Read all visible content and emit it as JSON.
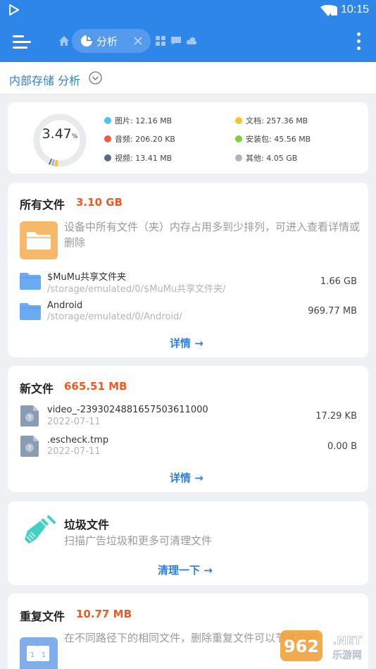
{
  "status_bar": {
    "time": "10:15"
  },
  "toolbar": {
    "active_tab_label": "分析"
  },
  "path": {
    "title": "内部存储 分析"
  },
  "storage_summary": {
    "percent_value": "3.47",
    "percent_sign": "%",
    "legend": [
      {
        "label": "图片: 12.16 MB",
        "color": "#4fc3f0"
      },
      {
        "label": "文档: 257.36 MB",
        "color": "#f7c52a"
      },
      {
        "label": "音频: 206.20 KB",
        "color": "#f05a44"
      },
      {
        "label": "安装包: 45.56 MB",
        "color": "#7dd13b"
      },
      {
        "label": "视频: 13.41 MB",
        "color": "#5a6b82"
      },
      {
        "label": "其他: 4.05 GB",
        "color": "#a9b6c7"
      }
    ]
  },
  "all_files": {
    "title": "所有文件",
    "size": "3.10 GB",
    "description": "设备中所有文件（夹）内存占用多到少排列，可进入查看详情或删除",
    "items": [
      {
        "name": "$MuMu共享文件夹",
        "path": "/storage/emulated/0/$MuMu共享文件夹/",
        "size": "1.66 GB"
      },
      {
        "name": "Android",
        "path": "/storage/emulated/0/Android/",
        "size": "969.77 MB"
      }
    ],
    "detail_label": "详情 →"
  },
  "new_files": {
    "title": "新文件",
    "size": "665.51 MB",
    "items": [
      {
        "name": "video_-2393024881657503611000",
        "date": "2022-07-11",
        "size": "17.29 KB"
      },
      {
        "name": ".escheck.tmp",
        "date": "2022-07-11",
        "size": "0.00 B"
      }
    ],
    "detail_label": "详情 →"
  },
  "junk_files": {
    "title": "垃圾文件",
    "description": "扫描广告垃圾和更多可清理文件",
    "action_label": "清理一下 →"
  },
  "duplicate_files": {
    "title": "重复文件",
    "size": "10.77 MB",
    "description": "在不同路径下的相同文件，删除重复文件可以节省空间"
  },
  "colors": {
    "accent": "#2f86e9",
    "link": "#2f7fdc",
    "size_highlight": "#f05a22",
    "folder": "#6aaaf0"
  }
}
